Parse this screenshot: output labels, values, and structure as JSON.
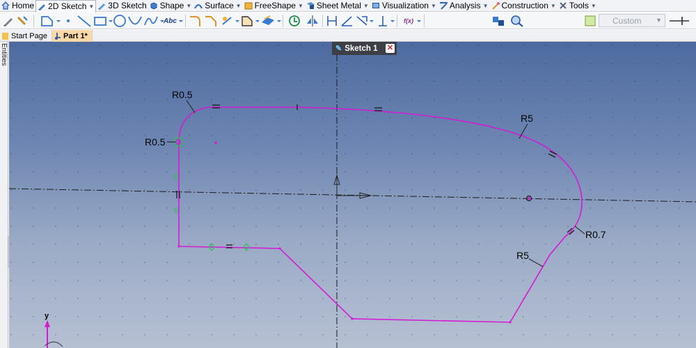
{
  "menu": {
    "tabs": [
      {
        "label": "Home",
        "icon": "home-icon",
        "active": false
      },
      {
        "label": "2D Sketch",
        "icon": "sketch-2d-icon",
        "active": true
      },
      {
        "label": "3D Sketch",
        "icon": "sketch-3d-icon",
        "active": false
      },
      {
        "label": "Shape",
        "icon": "shape-icon",
        "active": false
      },
      {
        "label": "Surface",
        "icon": "surface-icon",
        "active": false
      },
      {
        "label": "FreeShape",
        "icon": "freeshape-icon",
        "active": false
      },
      {
        "label": "Sheet Metal",
        "icon": "sheet-metal-icon",
        "active": false
      },
      {
        "label": "Visualization",
        "icon": "visualization-icon",
        "active": false
      },
      {
        "label": "Analysis",
        "icon": "analysis-icon",
        "active": false
      },
      {
        "label": "Construction",
        "icon": "construction-icon",
        "active": false
      },
      {
        "label": "Tools",
        "icon": "tools-icon",
        "active": false
      }
    ]
  },
  "toolbar": {
    "text_tool_label": "Abc",
    "function_tool_label": "f(x)",
    "preset_value": "Custom"
  },
  "doc_tabs": [
    {
      "label": "Start Page",
      "active": false
    },
    {
      "label": "Part 1*",
      "active": true
    }
  ],
  "side_panel": {
    "label": "Entities"
  },
  "sketch_tab": {
    "label": "Sketch 1"
  },
  "dimensions": {
    "r_top_left": "R0.5",
    "r_left_center": "R0.5",
    "r_top_right": "R5",
    "r_right": "R0.7",
    "r_bottom_right": "R5"
  },
  "axis": {
    "y_label": "y"
  },
  "colors": {
    "sketch_profile": "#d41bd4",
    "centerline": "#1a1a1a",
    "constraint_green": "#26c24b",
    "active_tab": "#fbd9a6"
  }
}
